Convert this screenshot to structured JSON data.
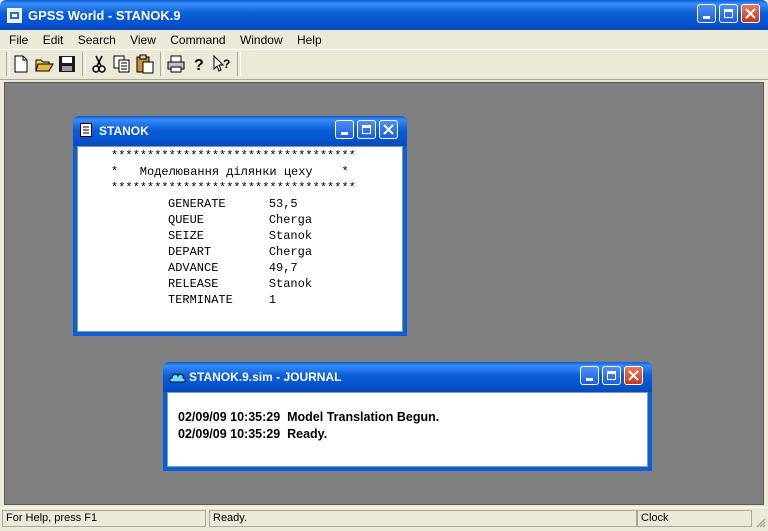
{
  "app": {
    "title": "GPSS World - STANOK.9"
  },
  "menu": {
    "file": "File",
    "edit": "Edit",
    "search": "Search",
    "view": "View",
    "command": "Command",
    "window": "Window",
    "help": "Help"
  },
  "toolbar": {
    "icons": [
      "new-icon",
      "open-icon",
      "save-icon",
      "cut-icon",
      "copy-icon",
      "paste-icon",
      "print-icon",
      "help-icon",
      "context-help-icon"
    ]
  },
  "model_window": {
    "title": "STANOK",
    "lines": [
      "**********************************",
      "*   Моделювання ділянки цеху    *",
      "**********************************",
      "GENERATE      53,5",
      "QUEUE         Cherga",
      "SEIZE         Stanok",
      "DEPART        Cherga",
      "ADVANCE       49,7",
      "RELEASE       Stanok",
      "TERMINATE     1"
    ]
  },
  "journal_window": {
    "title": "STANOK.9.sim  -  JOURNAL",
    "lines": [
      "02/09/09 10:35:29  Model Translation Begun.",
      "02/09/09 10:35:29  Ready."
    ]
  },
  "status": {
    "help": "For Help, press F1",
    "state": "Ready.",
    "clock": "Clock"
  },
  "colors": {
    "title_bar": "#0a5fd8",
    "mdi_background": "#808080",
    "close_button": "#c4391b"
  }
}
